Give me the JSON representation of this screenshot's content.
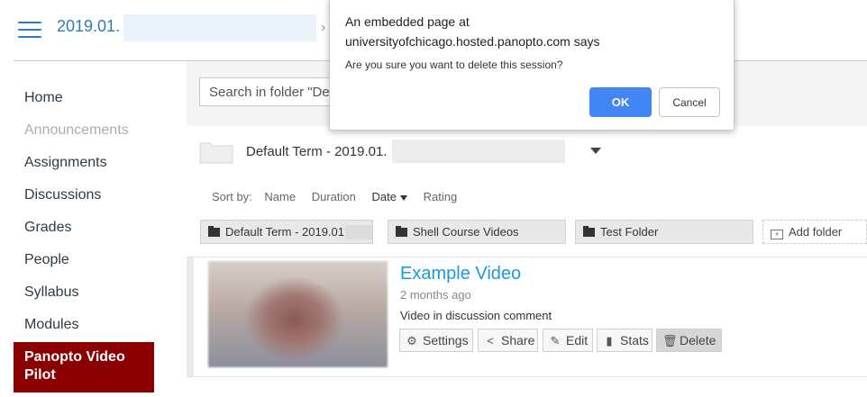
{
  "header": {
    "course_title": "2019.01.",
    "breadcrumb_separator": "›"
  },
  "nav": {
    "items": [
      {
        "label": "Home"
      },
      {
        "label": "Announcements"
      },
      {
        "label": "Assignments"
      },
      {
        "label": "Discussions"
      },
      {
        "label": "Grades"
      },
      {
        "label": "People"
      },
      {
        "label": "Syllabus"
      },
      {
        "label": "Modules"
      }
    ],
    "active_label": "Panopto Video Pilot"
  },
  "panopto": {
    "search_placeholder": "Search in folder \"Default Term - 2019.01.",
    "folder_name": "Default Term - 2019.01.",
    "sort": {
      "label": "Sort by:",
      "options": [
        "Name",
        "Duration",
        "Date",
        "Rating"
      ],
      "selected": "Date"
    },
    "subfolders": [
      {
        "label": "Default Term - 2019.01."
      },
      {
        "label": "Shell Course Videos"
      },
      {
        "label": "Test Folder"
      }
    ],
    "add_folder_label": "Add folder",
    "session": {
      "title": "Example Video",
      "date": "2 months ago",
      "description": "Video in discussion comment",
      "actions": [
        {
          "label": "Settings",
          "icon": "gear-icon"
        },
        {
          "label": "Share",
          "icon": "share-icon"
        },
        {
          "label": "Edit",
          "icon": "pencil-icon"
        },
        {
          "label": "Stats",
          "icon": "bar-chart-icon"
        },
        {
          "label": "Delete",
          "icon": "trash-icon"
        }
      ]
    }
  },
  "dialog": {
    "title_line1": "An embedded page at",
    "title_line2": "universityofchicago.hosted.panopto.com says",
    "message": "Are you sure you want to delete this session?",
    "ok_label": "OK",
    "cancel_label": "Cancel"
  },
  "colors": {
    "link_blue": "#2d7ab7",
    "panopto_blue": "#1a9ad6",
    "active_nav_bg": "#8b0000",
    "ok_button": "#4285f4"
  }
}
